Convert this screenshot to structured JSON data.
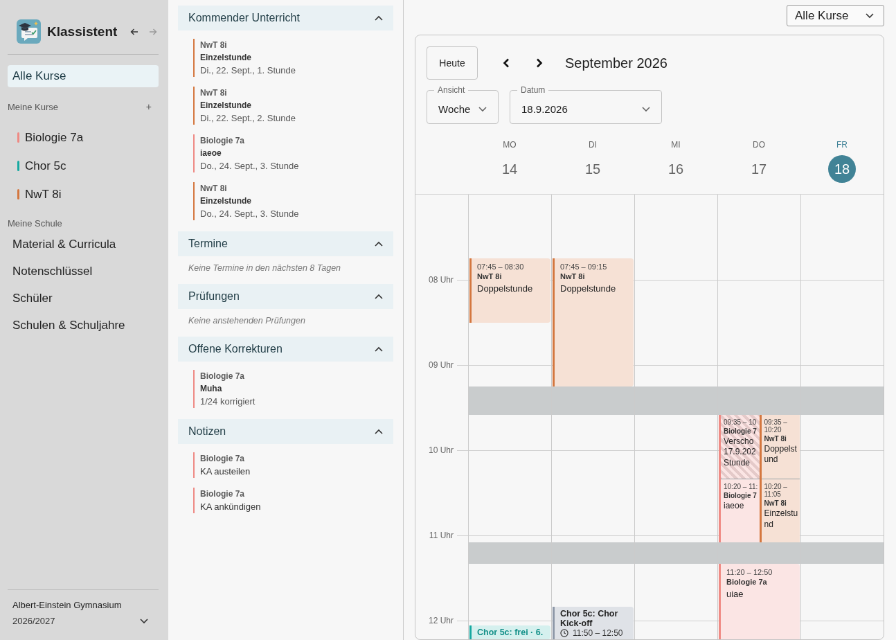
{
  "sidebar": {
    "app_name": "Klassistent",
    "history_buttons": [
      {
        "kind": "back",
        "disabled": false
      },
      {
        "kind": "forward",
        "disabled": true
      }
    ],
    "all_courses": {
      "label": "Alle Kurse",
      "selected": true
    },
    "my_courses_heading": "Meine Kurse",
    "add_label": "+",
    "courses": [
      {
        "name": "Biologie 7a",
        "color": "#ef8a84"
      },
      {
        "name": "Chor 5c",
        "color": "#17a9a1"
      },
      {
        "name": "NwT 8i",
        "color": "#d4773f"
      }
    ],
    "school_heading": "Meine Schule",
    "school_links": [
      "Material & Curricula",
      "Notenschlüssel",
      "Schüler",
      "Schulen & Schuljahre"
    ],
    "footer": {
      "school": "Albert-Einstein Gymnasium",
      "year": "2026/2027"
    }
  },
  "panels": [
    {
      "title": "Kommender Unterricht",
      "expanded": true,
      "items": [
        {
          "course": "NwT 8i",
          "color": "#d4773f",
          "title": "Einzelstunde",
          "detail": "Di., 22. Sept., 1. Stunde"
        },
        {
          "course": "NwT 8i",
          "color": "#d4773f",
          "title": "Einzelstunde",
          "detail": "Di., 22. Sept., 2. Stunde"
        },
        {
          "course": "Biologie 7a",
          "color": "#ef8a84",
          "title": "iaeoe",
          "detail": "Do., 24. Sept., 3. Stunde"
        },
        {
          "course": "NwT 8i",
          "color": "#d4773f",
          "title": "Einzelstunde",
          "detail": "Do., 24. Sept., 3. Stunde"
        }
      ]
    },
    {
      "title": "Termine",
      "expanded": true,
      "empty_text": "Keine Termine in den nächsten 8 Tagen"
    },
    {
      "title": "Prüfungen",
      "expanded": true,
      "empty_text": "Keine anstehenden Prüfungen"
    },
    {
      "title": "Offene Korrekturen",
      "expanded": true,
      "items": [
        {
          "course": "Biologie 7a",
          "color": "#ef8a84",
          "title": "Muha",
          "detail": "1/24 korrigiert"
        }
      ]
    },
    {
      "title": "Notizen",
      "expanded": true,
      "items": [
        {
          "course": "Biologie 7a",
          "color": "#ef8a84",
          "note": "KA austeilen"
        },
        {
          "course": "Biologie 7a",
          "color": "#ef8a84",
          "note": "KA ankündigen"
        }
      ]
    }
  ],
  "calendar": {
    "course_filter": "Alle Kurse",
    "today_button": "Heute",
    "month_title": "September 2026",
    "view_field": {
      "label": "Ansicht",
      "value": "Woche"
    },
    "date_field": {
      "label": "Datum",
      "value": "18.9.2026"
    },
    "hours": [
      "08 Uhr",
      "09 Uhr",
      "10 Uhr",
      "11 Uhr",
      "12 Uhr"
    ],
    "days": [
      {
        "weekday": "MO",
        "date": "14",
        "selected": false,
        "events": [
          {
            "kind": "lesson",
            "color": "#d4773f",
            "time": "07:45 – 08:30",
            "course": "NwT 8i",
            "title": "Doppelstunde",
            "shifted": false
          },
          {
            "kind": "free",
            "color": "#17a9a1",
            "title": "Chor 5c: frei · 6."
          }
        ]
      },
      {
        "weekday": "DI",
        "date": "15",
        "selected": false,
        "events": [
          {
            "kind": "lesson",
            "color": "#d4773f",
            "time": "07:45 – 09:15",
            "course": "NwT 8i",
            "title": "Doppelstunde",
            "shifted": false
          },
          {
            "kind": "appointment",
            "color": "#8e98a8",
            "title": "Chor 5c: Chor Kick-off",
            "time": "11:50 – 12:50"
          }
        ]
      },
      {
        "weekday": "MI",
        "date": "16",
        "selected": false
      },
      {
        "weekday": "DO",
        "date": "17",
        "selected": false,
        "events": [
          {
            "kind": "group",
            "lanes": [
              [
                {
                  "kind": "lesson",
                  "color": "#ef8a84",
                  "time": "09:35 – 10",
                  "course": "Biologie 7",
                  "title": "Verscho 17.9.202 Stunde",
                  "shifted": true
                },
                {
                  "kind": "lesson",
                  "color": "#ef8a84",
                  "time": "10:20 – 11:",
                  "course": "Biologie 7",
                  "title": "iaeoe",
                  "shifted": false
                }
              ],
              [
                {
                  "kind": "lesson",
                  "color": "#d4773f",
                  "time": "09:35 – 10:20",
                  "course": "NwT 8i",
                  "title": "Doppelstund",
                  "shifted": false
                },
                {
                  "kind": "lesson",
                  "color": "#d4773f",
                  "time": "10:20 – 11:05",
                  "course": "NwT 8i",
                  "title": "Einzelstund",
                  "shifted": false
                }
              ]
            ]
          },
          {
            "kind": "lesson",
            "color": "#ef8a84",
            "time": "11:20 – 12:50",
            "course": "Biologie 7a",
            "title": "uiae",
            "shifted": false
          }
        ]
      },
      {
        "weekday": "FR",
        "date": "18",
        "selected": true
      }
    ]
  }
}
